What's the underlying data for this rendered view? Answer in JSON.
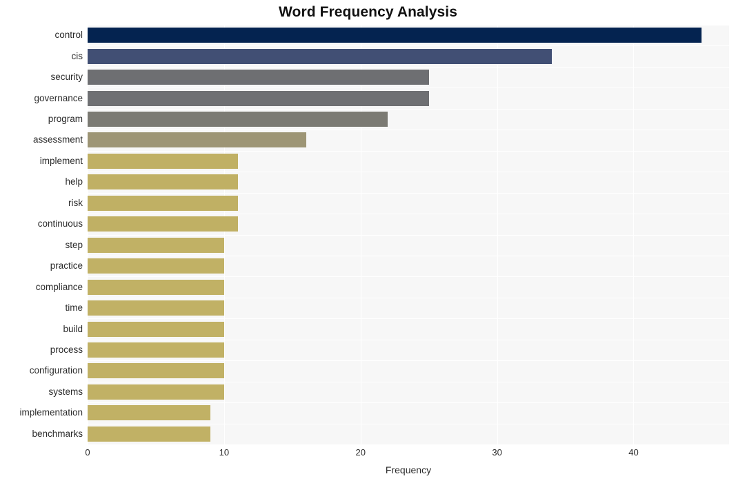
{
  "chart_data": {
    "type": "bar",
    "orientation": "horizontal",
    "title": "Word Frequency Analysis",
    "xlabel": "Frequency",
    "ylabel": "",
    "categories": [
      "control",
      "cis",
      "security",
      "governance",
      "program",
      "assessment",
      "implement",
      "help",
      "risk",
      "continuous",
      "step",
      "practice",
      "compliance",
      "time",
      "build",
      "process",
      "configuration",
      "systems",
      "implementation",
      "benchmarks"
    ],
    "values": [
      45,
      34,
      25,
      25,
      22,
      16,
      11,
      11,
      11,
      11,
      10,
      10,
      10,
      10,
      10,
      10,
      10,
      10,
      9,
      9
    ],
    "bar_colors": [
      "#042350",
      "#414f74",
      "#6e6f72",
      "#6f7073",
      "#7b7a73",
      "#9d9575",
      "#c0b064",
      "#c0b064",
      "#c0b064",
      "#c0b064",
      "#c1b165",
      "#c1b165",
      "#c1b165",
      "#c1b165",
      "#c1b165",
      "#c1b165",
      "#c1b165",
      "#c1b165",
      "#c1b165",
      "#c1b165"
    ],
    "xlim": [
      0,
      47
    ],
    "xticks": [
      0,
      10,
      20,
      30,
      40
    ],
    "xtick_labels": [
      "0",
      "10",
      "20",
      "30",
      "40"
    ],
    "grid": true,
    "grid_color": "#ffffff",
    "plot_background": "#f7f7f7",
    "figure_background": "#ffffff",
    "legend": null
  }
}
